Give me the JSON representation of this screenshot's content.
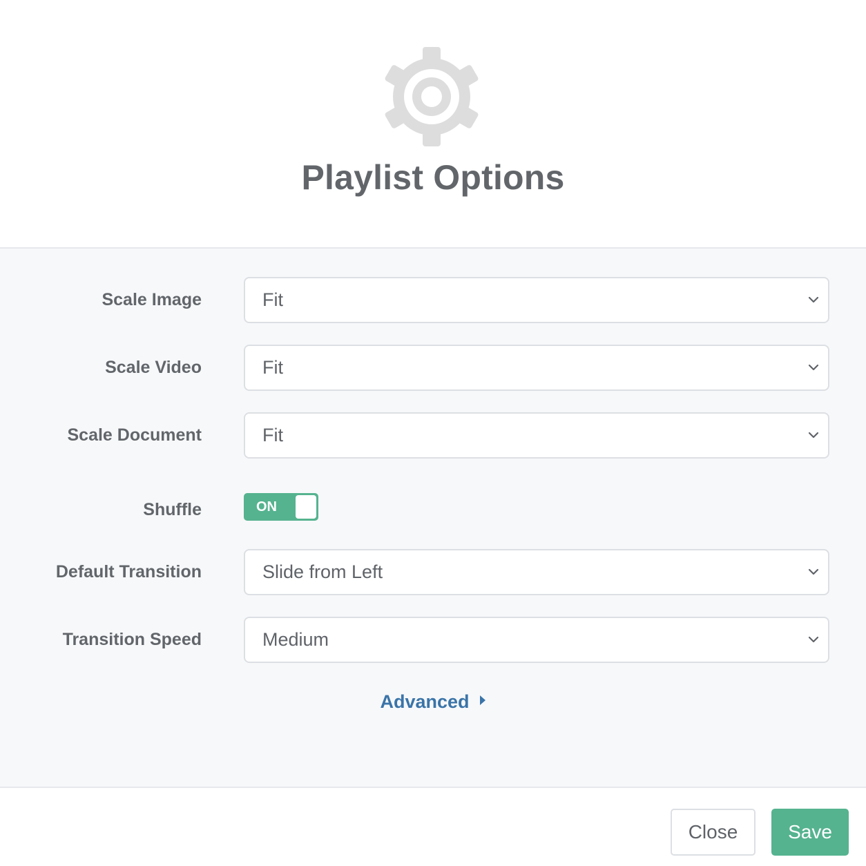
{
  "dialog": {
    "title": "Playlist Options",
    "icon": "gear-icon"
  },
  "fields": {
    "scale_image": {
      "label": "Scale Image",
      "value": "Fit"
    },
    "scale_video": {
      "label": "Scale Video",
      "value": "Fit"
    },
    "scale_document": {
      "label": "Scale Document",
      "value": "Fit"
    },
    "shuffle": {
      "label": "Shuffle",
      "state_text": "ON"
    },
    "default_transition": {
      "label": "Default Transition",
      "value": "Slide from Left"
    },
    "transition_speed": {
      "label": "Transition Speed",
      "value": "Medium"
    }
  },
  "advanced": {
    "label": "Advanced",
    "icon": "caret-right-icon"
  },
  "footer": {
    "close_label": "Close",
    "save_label": "Save"
  },
  "colors": {
    "accent_green": "#55b38f",
    "link_blue": "#3a74a8",
    "text_gray": "#62666a",
    "panel_bg": "#f7f8fa"
  }
}
